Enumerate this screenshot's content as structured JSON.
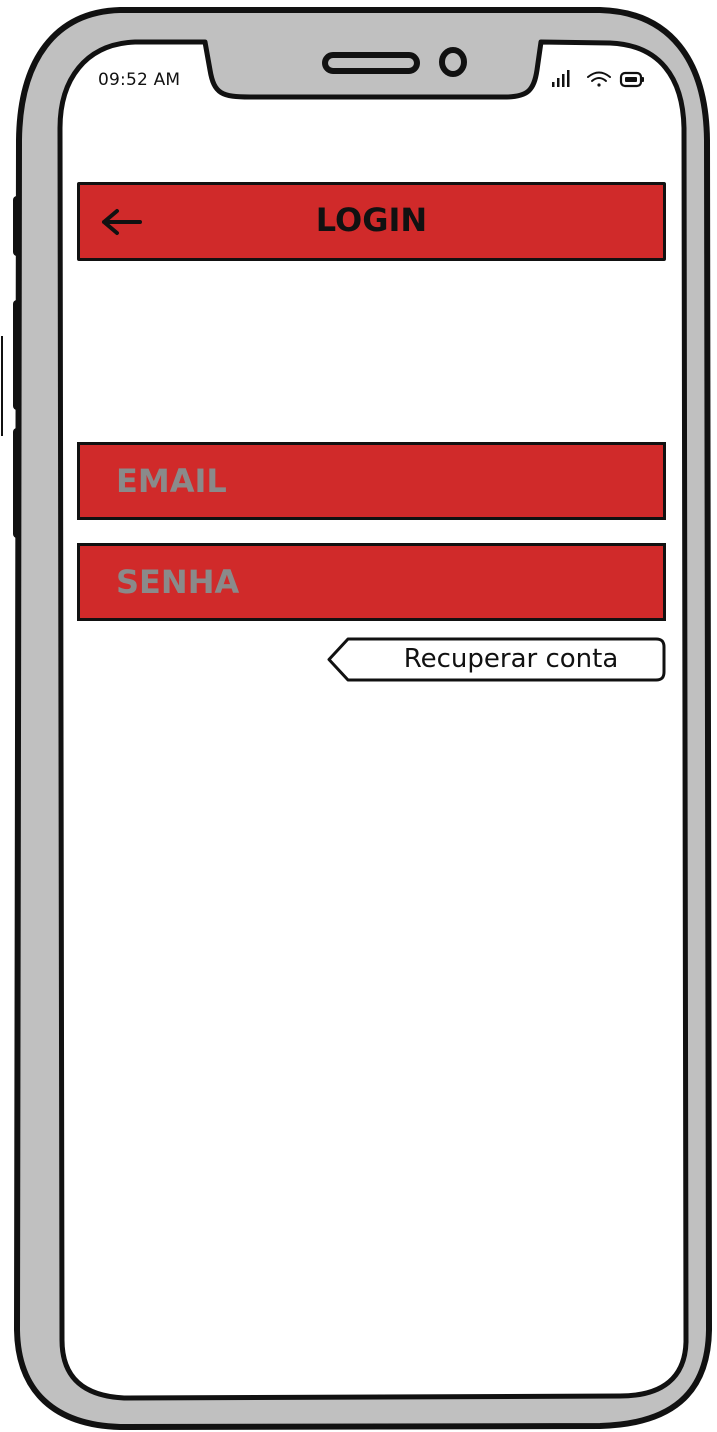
{
  "status_bar": {
    "time": "09:52 AM",
    "icons": [
      "signal-icon",
      "wifi-icon",
      "battery-icon"
    ]
  },
  "header": {
    "title": "LOGIN",
    "back_icon": "arrow-left-icon"
  },
  "form": {
    "email_placeholder": "EMAIL",
    "email_value": "",
    "password_placeholder": "SENHA",
    "password_value": ""
  },
  "recover_link": {
    "label": "Recuperar conta"
  },
  "colors": {
    "accent": "#d02a2a",
    "frame": "#c0c0c0",
    "outline": "#111111",
    "placeholder": "#8a8a8a",
    "screen": "#ffffff"
  }
}
